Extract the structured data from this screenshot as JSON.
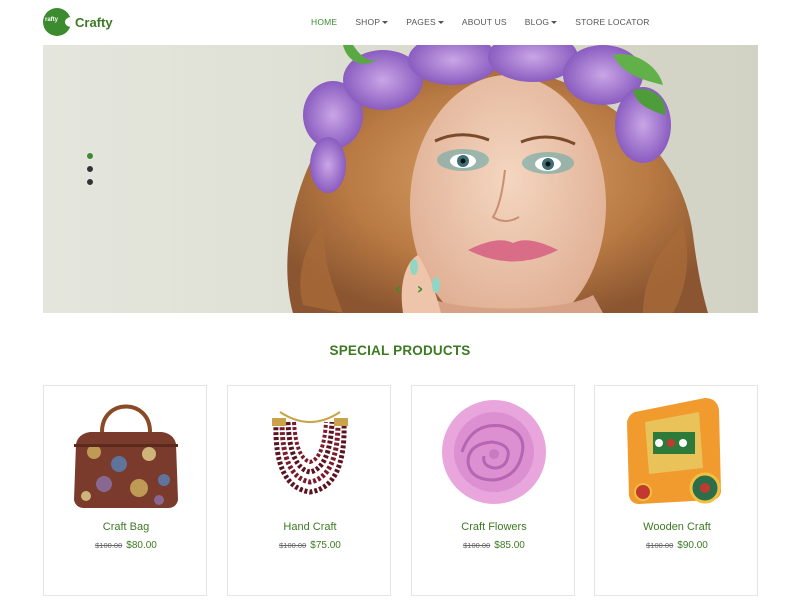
{
  "brand": {
    "name": "Crafty",
    "badge_text": "rafty"
  },
  "nav": {
    "items": [
      {
        "label": "HOME",
        "active": true,
        "dropdown": false
      },
      {
        "label": "SHOP",
        "active": false,
        "dropdown": true
      },
      {
        "label": "PAGES",
        "active": false,
        "dropdown": true
      },
      {
        "label": "ABOUT US",
        "active": false,
        "dropdown": false
      },
      {
        "label": "BLOG",
        "active": false,
        "dropdown": true
      },
      {
        "label": "STORE LOCATOR",
        "active": false,
        "dropdown": false
      }
    ]
  },
  "hero": {
    "slide_count": 3,
    "active_slide": 1
  },
  "section": {
    "title": "SPECIAL PRODUCTS"
  },
  "products": [
    {
      "name": "Craft Bag",
      "old_price": "$100.00",
      "price": "$80.00",
      "icon": "handbag-image"
    },
    {
      "name": "Hand Craft",
      "old_price": "$100.00",
      "price": "$75.00",
      "icon": "necklace-image"
    },
    {
      "name": "Craft Flowers",
      "old_price": "$100.00",
      "price": "$85.00",
      "icon": "flower-image"
    },
    {
      "name": "Wooden Craft",
      "old_price": "$100.00",
      "price": "$90.00",
      "icon": "wooden-holder-image"
    }
  ],
  "colors": {
    "brand_green": "#3d8b2f",
    "text_green": "#3d7a23"
  }
}
